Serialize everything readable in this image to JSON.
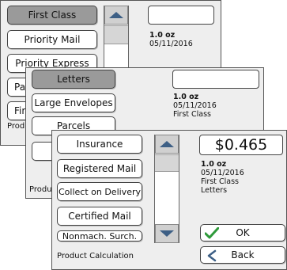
{
  "panel1": {
    "buttons": [
      "First Class",
      "Priority Mail",
      "Priority Express",
      "Pa",
      "First"
    ],
    "footer": "Produ",
    "weight": "1.0 oz",
    "date": "05/11/2016"
  },
  "panel2": {
    "buttons": [
      "Letters",
      "Large Envelopes",
      "Parcels"
    ],
    "footer": "Produ",
    "weight": "1.0 oz",
    "date": "05/11/2016",
    "class": "First Class"
  },
  "panel3": {
    "buttons": [
      "Insurance",
      "Registered Mail",
      "Collect on Delivery",
      "Certified Mail",
      "Nonmach. Surch."
    ],
    "footer": "Product Calculation",
    "price": "$0.465",
    "weight": "1.0 oz",
    "date": "05/11/2016",
    "class": "First Class",
    "shape": "Letters",
    "ok_label": "OK",
    "back_label": "Back"
  },
  "colors": {
    "check": "#2e9a3a",
    "arrow": "#3d5f85"
  }
}
